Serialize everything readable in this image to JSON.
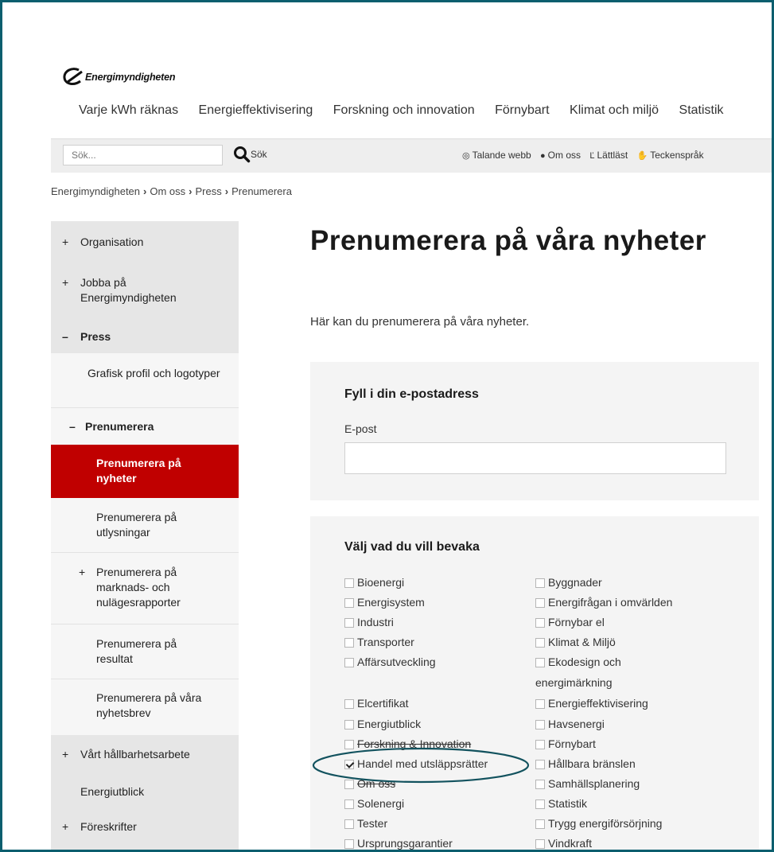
{
  "logo": {
    "name": "Energimyndigheten"
  },
  "main_nav": [
    "Varje kWh räknas",
    "Energieffektivisering",
    "Forskning och innovation",
    "Förnybart",
    "Klimat och miljö",
    "Statistik"
  ],
  "search": {
    "placeholder": "Sök...",
    "button_label": "Sök"
  },
  "toolbar": [
    {
      "icon": "ear-icon",
      "glyph": "◎",
      "label": "Talande webb"
    },
    {
      "icon": "person-icon",
      "glyph": "👤",
      "label": "Om oss"
    },
    {
      "icon": "easy-read-icon",
      "glyph": "Ľ",
      "label": "Lättläst"
    },
    {
      "icon": "sign-language-icon",
      "glyph": "✋",
      "label": "Teckenspråk"
    }
  ],
  "breadcrumb": [
    "Energimyndigheten",
    "Om oss",
    "Press",
    "Prenumerera"
  ],
  "sidebar": {
    "items": [
      {
        "label": "Organisation",
        "prefix": "+"
      },
      {
        "label": "Jobba på Energimyndigheten",
        "prefix": "+"
      },
      {
        "label": "Press",
        "prefix": "–"
      },
      {
        "label": "Grafisk profil och logotyper",
        "prefix": ""
      },
      {
        "label": "Prenumerera",
        "prefix": "–"
      },
      {
        "label": "Prenumerera på nyheter",
        "prefix": ""
      },
      {
        "label": "Prenumerera på utlysningar",
        "prefix": ""
      },
      {
        "label": "Prenumerera på marknads- och nulägesrapporter",
        "prefix": "+"
      },
      {
        "label": "Prenumerera på resultat",
        "prefix": ""
      },
      {
        "label": "Prenumerera på våra nyhetsbrev",
        "prefix": ""
      },
      {
        "label": "Vårt hållbarhetsarbete",
        "prefix": "+"
      },
      {
        "label": "Energiutblick",
        "prefix": ""
      },
      {
        "label": "Föreskrifter",
        "prefix": "+"
      }
    ]
  },
  "page": {
    "title": "Prenumerera på våra nyheter",
    "intro": "Här kan du prenumerera på våra nyheter."
  },
  "email_form": {
    "heading": "Fyll i din e-postadress",
    "label": "E-post",
    "value": ""
  },
  "topics": {
    "heading": "Välj vad du vill bevaka",
    "left": [
      {
        "label": "Bioenergi",
        "checked": false
      },
      {
        "label": "Energisystem",
        "checked": false
      },
      {
        "label": "Industri",
        "checked": false
      },
      {
        "label": "Transporter",
        "checked": false
      },
      {
        "label": "Affärsutveckling",
        "checked": false
      },
      {
        "label": "Elcertifikat",
        "checked": false
      },
      {
        "label": "Energiutblick",
        "checked": false
      },
      {
        "label": "Forskning & Innovation",
        "checked": false
      },
      {
        "label": "Handel med utsläppsrätter",
        "checked": true
      },
      {
        "label": "Om oss",
        "checked": false
      },
      {
        "label": "Solenergi",
        "checked": false
      },
      {
        "label": "Tester",
        "checked": false
      },
      {
        "label": "Ursprungsgarantier",
        "checked": false
      }
    ],
    "right": [
      {
        "label": "Byggnader",
        "checked": false
      },
      {
        "label": "Energifrågan i omvärlden",
        "checked": false
      },
      {
        "label": "Förnybar el",
        "checked": false
      },
      {
        "label": "Klimat & Miljö",
        "checked": false
      },
      {
        "label": "Ekodesign och",
        "checked": false
      },
      {
        "label": "energimärkning",
        "checked": false
      },
      {
        "label": "Energieffektivisering",
        "checked": false
      },
      {
        "label": "Havsenergi",
        "checked": false
      },
      {
        "label": "Förnybart",
        "checked": false
      },
      {
        "label": "Hållbara bränslen",
        "checked": false
      },
      {
        "label": "Samhällsplanering",
        "checked": false
      },
      {
        "label": "Statistik",
        "checked": false
      },
      {
        "label": "Trygg energiförsörjning",
        "checked": false
      },
      {
        "label": "Vindkraft",
        "checked": false
      }
    ]
  },
  "colors": {
    "active_red": "#c00000",
    "frame": "#0b5e6e",
    "highlight": "#12525e"
  }
}
